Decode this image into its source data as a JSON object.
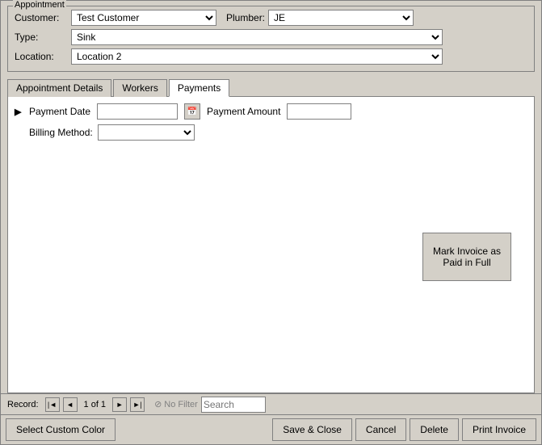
{
  "window": {
    "group_label": "Appointment"
  },
  "form": {
    "customer_label": "Customer:",
    "customer_value": "Test Customer",
    "plumber_label": "Plumber:",
    "plumber_value": "JE",
    "type_label": "Type:",
    "type_value": "Sink",
    "location_label": "Location:",
    "location_value": "Location 2"
  },
  "tabs": [
    {
      "id": "appointment-details",
      "label": "Appointment Details"
    },
    {
      "id": "workers",
      "label": "Workers"
    },
    {
      "id": "payments",
      "label": "Payments"
    }
  ],
  "payments": {
    "payment_date_label": "Payment Date",
    "payment_amount_label": "Payment Amount",
    "billing_method_label": "Billing Method:",
    "mark_invoice_label": "Mark Invoice as Paid in Full"
  },
  "record_nav": {
    "label": "Record:",
    "first_icon": "⊣",
    "prev_icon": "◄",
    "next_icon": "►",
    "last_icon": "⊢",
    "count": "1 of 1",
    "no_filter_icon": "⊘",
    "no_filter_label": "No Filter",
    "search_placeholder": "Search"
  },
  "toolbar": {
    "select_color_label": "Select Custom Color",
    "save_close_label": "Save & Close",
    "cancel_label": "Cancel",
    "delete_label": "Delete",
    "print_invoice_label": "Print Invoice"
  }
}
